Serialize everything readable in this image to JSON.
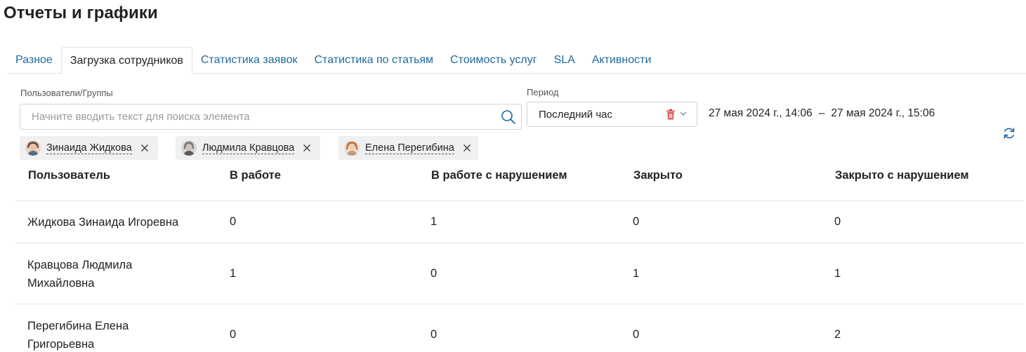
{
  "page": {
    "title": "Отчеты и графики"
  },
  "tabs": [
    {
      "label": "Разное",
      "active": false
    },
    {
      "label": "Загрузка сотрудников",
      "active": true
    },
    {
      "label": "Статистика заявок",
      "active": false
    },
    {
      "label": "Статистика по статьям",
      "active": false
    },
    {
      "label": "Стоимость услуг",
      "active": false
    },
    {
      "label": "SLA",
      "active": false
    },
    {
      "label": "Активности",
      "active": false
    }
  ],
  "filters": {
    "users_label": "Пользователи/Группы",
    "search_placeholder": "Начните вводить текст для поиска элемента",
    "search_value": "",
    "period_label": "Период",
    "period_value": "Последний час",
    "date_from": "27 мая 2024 г., 14:06",
    "date_separator": "–",
    "date_to": "27 мая 2024 г., 15:06"
  },
  "chips": [
    {
      "label": "Зинаида Жидкова",
      "avatar_color": "#b0806a"
    },
    {
      "label": "Людмила Кравцова",
      "avatar_color": "#8a8a8a"
    },
    {
      "label": "Елена Перегибина",
      "avatar_color": "#c8906e"
    }
  ],
  "table": {
    "columns": [
      "Пользователь",
      "В работе",
      "В работе с нарушением",
      "Закрыто",
      "Закрыто с нарушением"
    ],
    "rows": [
      {
        "name": [
          "Жидкова Зинаида Игоревна"
        ],
        "values": [
          "0",
          "1",
          "0",
          "0"
        ]
      },
      {
        "name": [
          "Кравцова Людмила",
          "Михайловна"
        ],
        "values": [
          "1",
          "0",
          "1",
          "1"
        ]
      },
      {
        "name": [
          "Перегибина Елена",
          "Григорьевна"
        ],
        "values": [
          "0",
          "0",
          "0",
          "2"
        ]
      }
    ]
  },
  "colors": {
    "link": "#1f6a9a",
    "trash": "#d9534f",
    "border": "#e2e2e2"
  }
}
